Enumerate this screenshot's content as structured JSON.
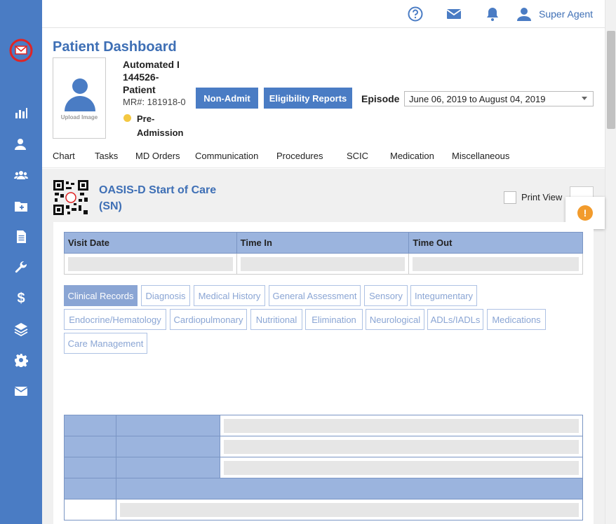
{
  "topbar": {
    "user_name": "Super Agent"
  },
  "header": {
    "page_title": "Patient Dashboard",
    "upload_label": "Upload Image",
    "patient_name_line1": "Automated I",
    "patient_name_line2": "144526-",
    "patient_name_line3": "Patient",
    "mr": "MR#: 181918-0",
    "status_line1": "Pre-",
    "status_line2": "Admission",
    "status_color": "#f4c842",
    "non_admit_label": "Non-Admit",
    "eligibility_label": "Eligibility Reports",
    "episode_label": "Episode",
    "episode_value": "June 06, 2019 to August 04, 2019"
  },
  "tabs": [
    "Chart",
    "Tasks",
    "MD Orders",
    "Communication",
    "Procedures",
    "SCIC",
    "Medication",
    "Miscellaneous"
  ],
  "form": {
    "title_line1": "OASIS-D Start of Care",
    "title_line2": "(SN)",
    "print_view_label": "Print View",
    "alert_symbol": "!"
  },
  "visit_table": {
    "headers": [
      "Visit Date",
      "Time In",
      "Time Out"
    ]
  },
  "section_tabs": [
    "Clinical Records",
    "Diagnosis",
    "Medical History",
    "General Assessment",
    "Sensory",
    "Integumentary",
    "Endocrine/Hematology",
    "Cardiopulmonary",
    "Nutritional",
    "Elimination",
    "Neurological",
    "ADLs/IADLs",
    "Medications",
    "Care Management"
  ],
  "colors": {
    "sidebar": "#4a7cc4",
    "accent": "#3e6fb5",
    "table_header": "#9bb4de",
    "alert": "#f29b2c"
  }
}
